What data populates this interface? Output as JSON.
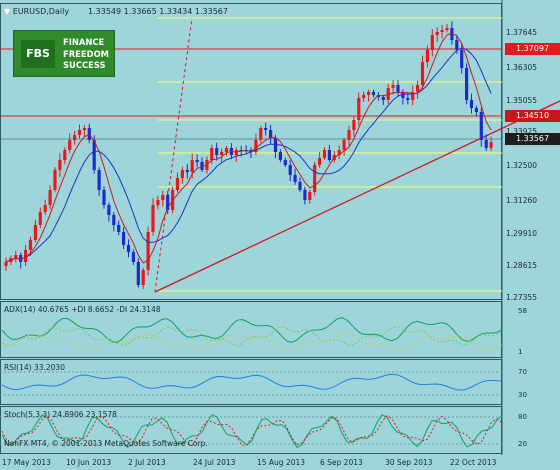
{
  "chart": {
    "symbol_header": "EURUSD,Daily",
    "ohlc_header": "1.33549 1.33665 1.33434 1.33567",
    "price_axis": [
      "1.37645",
      "1.36305",
      "1.35055",
      "1.33925",
      "1.32500",
      "1.31260",
      "1.29910",
      "1.28615",
      "1.27355"
    ],
    "price_tags": [
      {
        "label": "1.37097",
        "color": "#e8191d"
      },
      {
        "label": "1.34510",
        "color": "#c8171a"
      },
      {
        "label": "1.33567",
        "color": "#1e1e1e"
      }
    ],
    "fib_levels": [
      "0.0",
      "23.6",
      "38.2",
      "50.0",
      "61.8",
      "100.0"
    ],
    "colors": {
      "background": "#9ed5da",
      "bull_candle": "#e8191d",
      "bear_candle": "#1d2bc8",
      "fib_line": "#ffff66",
      "trendline": "#d4141a",
      "ma_fast": "#c41b22",
      "ma_slow": "#2030c8"
    }
  },
  "logo": {
    "mark": "FBS",
    "lines": [
      "FINANCE",
      "FREEDOM",
      "SUCCESS"
    ]
  },
  "adx": {
    "header": "ADX(14) 40.6765 +DI 8.6652 -DI 24.3148",
    "axis": [
      "58",
      "1"
    ]
  },
  "rsi": {
    "header": "RSI(14) 33.2030",
    "axis": [
      "70",
      "30"
    ]
  },
  "stoch": {
    "header": "Stoch(5,3,3) 24.8906 23.1578",
    "axis": [
      "80",
      "20"
    ],
    "copyright": "NonFX MT4, © 2001-2013 MetaQuotes Software Corp."
  },
  "time_axis": [
    "17 May 2013",
    "10 Jun 2013",
    "2 Jul 2013",
    "24 Jul 2013",
    "15 Aug 2013",
    "6 Sep 2013",
    "30 Sep 2013",
    "22 Oct 2013"
  ]
}
